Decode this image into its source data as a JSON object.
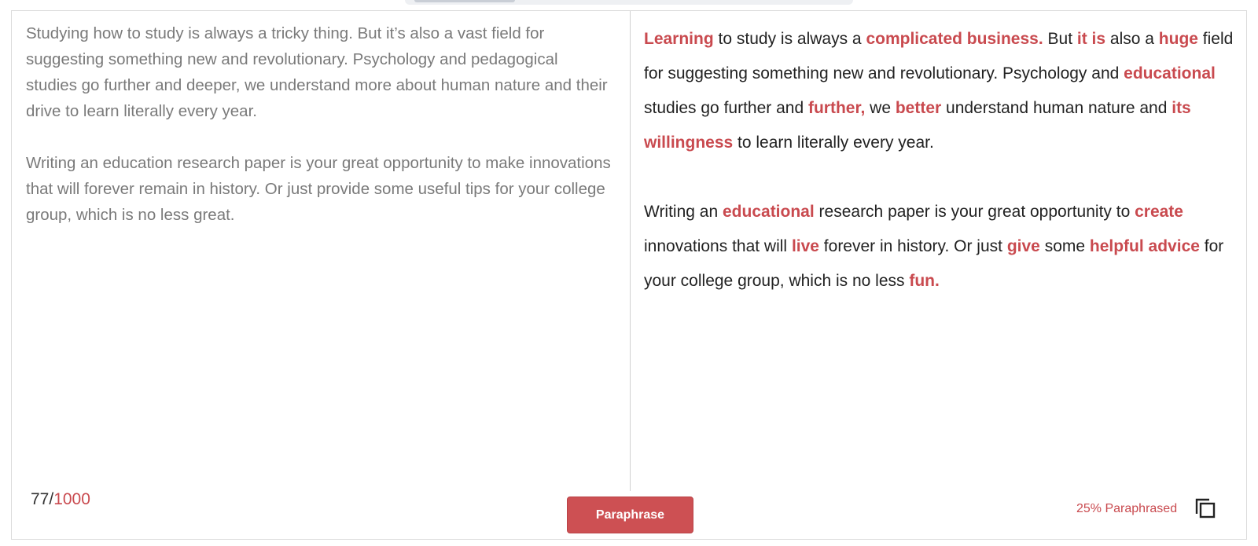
{
  "left_panel": {
    "paragraphs": [
      "Studying how to study is always a tricky thing. But it’s also a vast field for suggesting something new and revolutionary. Psychology and pedagogical studies go further and deeper, we understand more about human nature and their drive to learn literally every year.",
      "Writing an education research paper is your great opportunity to make innovations that will forever remain in history. Or just provide some useful tips for your college group, which is no less great."
    ],
    "counter_value": "77/",
    "counter_limit": "1000"
  },
  "right_panel": {
    "paragraphs": [
      [
        {
          "t": "Learning",
          "changed": true
        },
        {
          "t": " to study is always a ",
          "changed": false
        },
        {
          "t": "complicated business.",
          "changed": true
        },
        {
          "t": " But ",
          "changed": false
        },
        {
          "t": "it is",
          "changed": true
        },
        {
          "t": " also a ",
          "changed": false
        },
        {
          "t": "huge",
          "changed": true
        },
        {
          "t": " field for suggesting something new and revolutionary. Psychology and ",
          "changed": false
        },
        {
          "t": "educational",
          "changed": true
        },
        {
          "t": " studies go further and ",
          "changed": false
        },
        {
          "t": "further,",
          "changed": true
        },
        {
          "t": " we ",
          "changed": false
        },
        {
          "t": "better",
          "changed": true
        },
        {
          "t": " understand human nature and ",
          "changed": false
        },
        {
          "t": "its willingness",
          "changed": true
        },
        {
          "t": " to learn literally every year.",
          "changed": false
        }
      ],
      [
        {
          "t": "Writing an ",
          "changed": false
        },
        {
          "t": "educational",
          "changed": true
        },
        {
          "t": " research paper is your great opportunity to ",
          "changed": false
        },
        {
          "t": "create",
          "changed": true
        },
        {
          "t": " innovations that will ",
          "changed": false
        },
        {
          "t": "live",
          "changed": true
        },
        {
          "t": " forever in history. Or just ",
          "changed": false
        },
        {
          "t": "give",
          "changed": true
        },
        {
          "t": " some ",
          "changed": false
        },
        {
          "t": "helpful advice",
          "changed": true
        },
        {
          "t": " for your college group, which is no less ",
          "changed": false
        },
        {
          "t": "fun.",
          "changed": true
        }
      ]
    ],
    "paraphrased_label": "25% Paraphrased"
  },
  "actions": {
    "paraphrase_label": "Paraphrase",
    "copy_icon": "copy-icon"
  },
  "colors": {
    "accent": "#cd5053",
    "highlight_text": "#c94a4f",
    "source_text": "#7a7a7a"
  }
}
